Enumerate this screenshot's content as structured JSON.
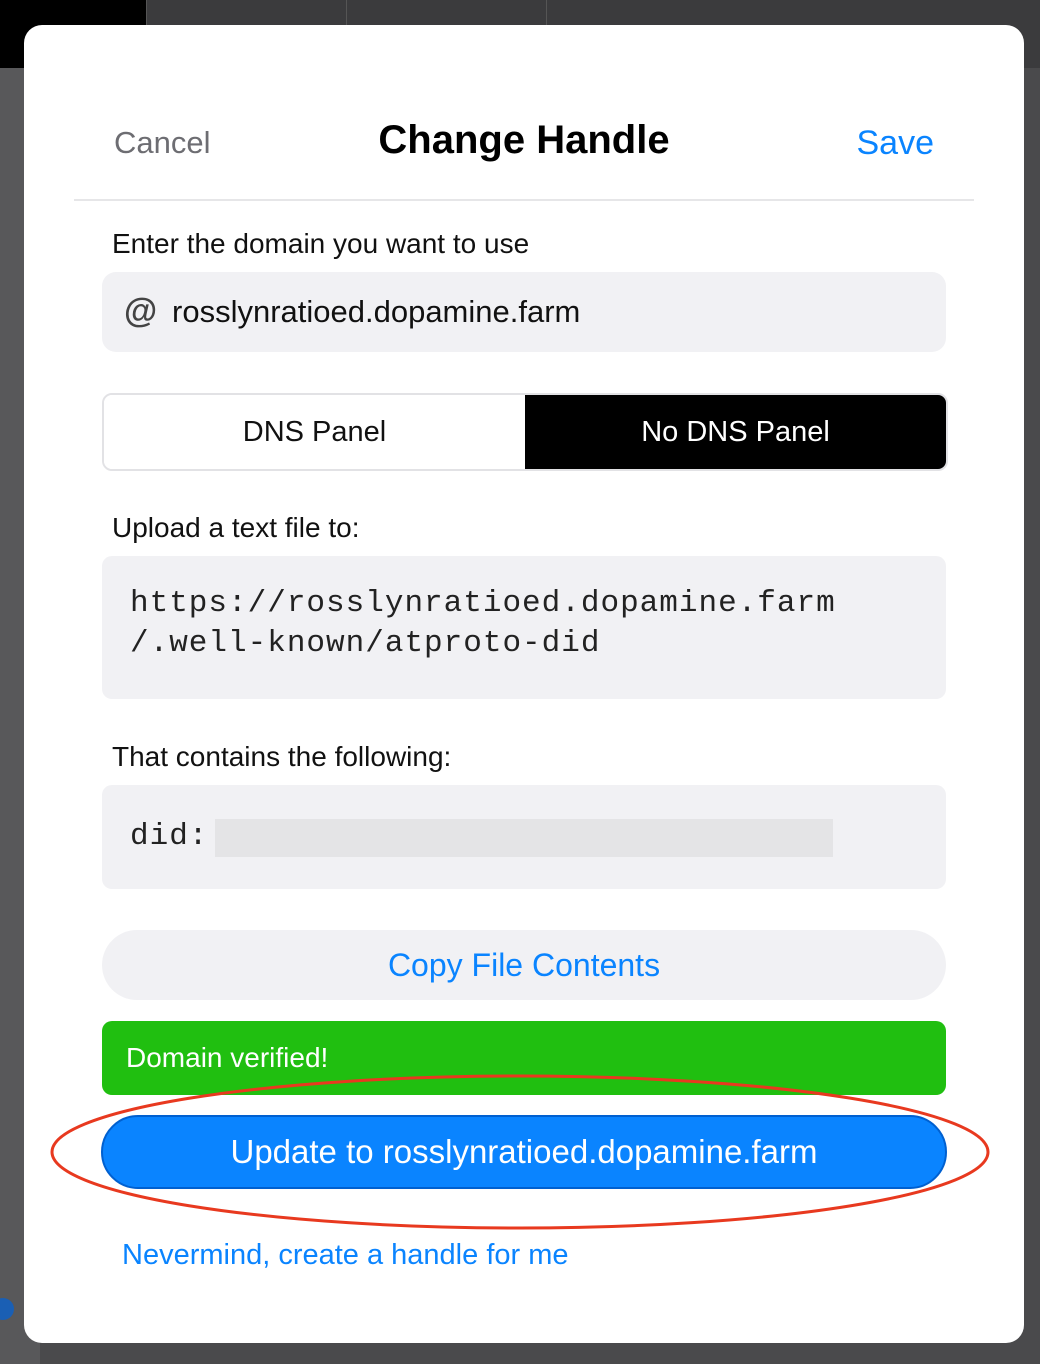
{
  "modal": {
    "cancel_label": "Cancel",
    "title": "Change Handle",
    "save_label": "Save",
    "domain_prompt": "Enter the domain you want to use",
    "at_symbol": "@",
    "domain_value": "rosslynratioed.dopamine.farm",
    "toggle": {
      "options": [
        "DNS Panel",
        "No DNS Panel"
      ],
      "selected": "No DNS Panel"
    },
    "upload_label": "Upload a text file to:",
    "upload_url_line1": "https://rosslynratioed.dopamine.farm",
    "upload_url_line2": "/.well-known/atproto-did",
    "contains_label": "That contains the following:",
    "did_prefix": "did:",
    "copy_button": "Copy File Contents",
    "verified_text": "Domain verified!",
    "update_button": "Update to rosslynratioed.dopamine.farm",
    "nevermind_link": "Nevermind, create a handle for me"
  },
  "colors": {
    "accent": "#0a84ff",
    "success": "#20bf10",
    "annotation": "#e8391f"
  }
}
